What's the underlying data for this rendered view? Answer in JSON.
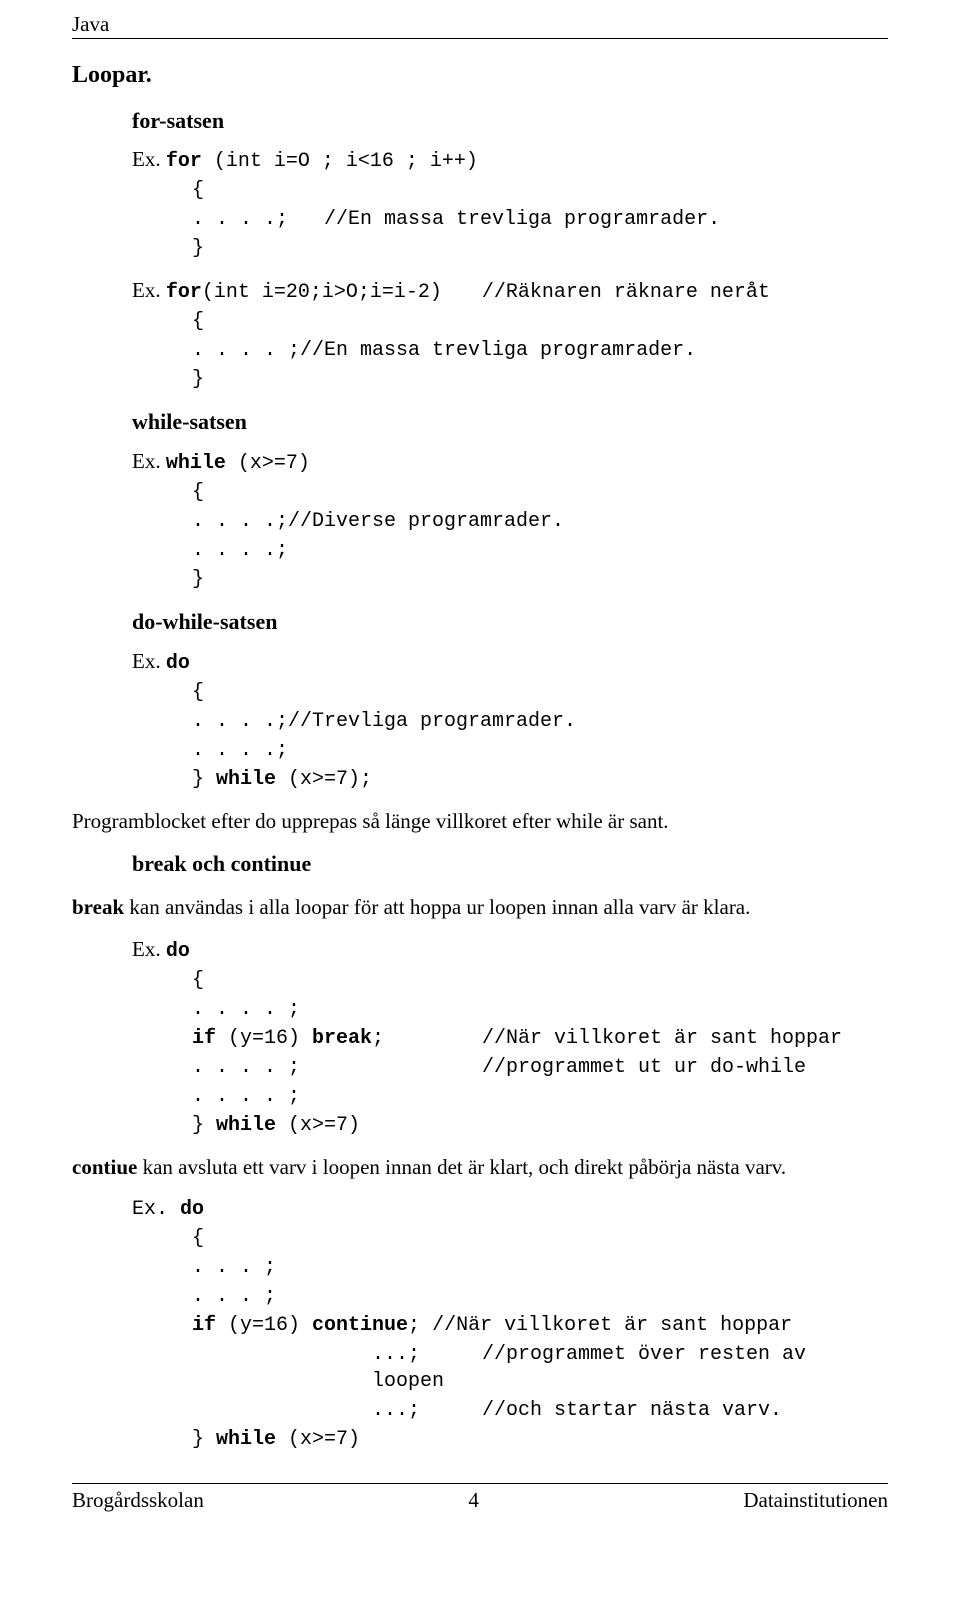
{
  "header": {
    "title": "Java"
  },
  "h1": "Loopar.",
  "sections": {
    "for": {
      "title": "for-satsen",
      "ex1": {
        "line1_prefix": "Ex. ",
        "line1_code_bold": "for",
        "line1_code_rest": " (int i=O ; i<16 ; i++)",
        "line2": "{",
        "line3_code": ". . . .;",
        "line3_comment": "//En massa trevliga programrader.",
        "line4": "}"
      },
      "ex2": {
        "line1_prefix": "Ex. ",
        "line1_code_bold": "for",
        "line1_code_rest": " (int i=20;i>O;i=i-2)",
        "line1_comment": "//Räknaren räknare neråt",
        "line2": "{",
        "line3": ". . . . ;//En massa trevliga programrader.",
        "line4": "}"
      }
    },
    "while": {
      "title": "while-satsen",
      "ex": {
        "line1_prefix": "Ex. ",
        "line1_code_bold": "while",
        "line1_code_rest": " (x>=7)",
        "line2": "{",
        "line3": ". . . .;//Diverse programrader.",
        "line4": ". . . .;",
        "line5": "}"
      }
    },
    "dowhile": {
      "title": "do-while-satsen",
      "ex": {
        "line1_prefix": "Ex. ",
        "line1_code_bold": "do",
        "line2": "{",
        "line3": ". . . .;//Trevliga programrader.",
        "line4": ". . . .;",
        "line5_a": "} ",
        "line5_bold": "while",
        "line5_b": " (x>=7);"
      },
      "para": "Programblocket efter do upprepas så länge villkoret efter while är sant."
    },
    "breakcont": {
      "title": "break och continue",
      "intro_bold": "break",
      "intro_rest": " kan användas i alla loopar för att hoppa ur loopen innan alla varv är klara.",
      "ex1": {
        "line1_prefix": "Ex. ",
        "line1_bold": "do",
        "line2": "{",
        "line3": ". . . . ;",
        "line4_a": "if",
        "line4_b": " (y=16) ",
        "line4_c": "break",
        "line4_d": ";",
        "line4_comment": "//När villkoret är sant hoppar",
        "line5": ". . . . ;",
        "line5_comment": "//programmet ut ur do-while",
        "line6": ". . . . ;",
        "line7_a": "} ",
        "line7_bold": "while",
        "line7_b": " (x>=7)"
      },
      "para2_bold": "contiue",
      "para2_rest": " kan  avsluta ett varv i loopen innan det är klart, och direkt påbörja nästa varv.",
      "ex2": {
        "line1_prefix": "Ex.",
        "line1_bold": " do",
        "line2": "{",
        "line3": ". . . ;",
        "line4": ". . . ;",
        "line5_a": "if",
        "line5_b": " (y=16) ",
        "line5_c": "continue",
        "line5_d": ";",
        "line5_comment": "//När villkoret är sant hoppar",
        "line6": "...;",
        "line6_comment": "//programmet över resten av loopen",
        "line7": "...;",
        "line7_comment": "//och startar nästa varv.",
        "line8_a": "} ",
        "line8_bold": "while",
        "line8_b": " (x>=7)"
      }
    }
  },
  "footer": {
    "left": "Brogårdsskolan",
    "center": "4",
    "right": "Datainstitutionen"
  }
}
